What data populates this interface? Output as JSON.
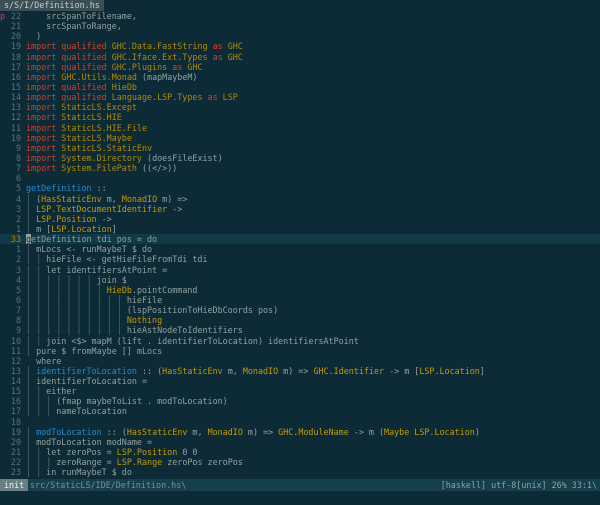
{
  "tab": {
    "title": "s/S/I/Definition.hs"
  },
  "sign_marker": "p",
  "lines": [
    {
      "n": "22",
      "sign": true,
      "segs": [
        [
          "i",
          "    "
        ],
        [
          "s",
          "srcSpanToFilename,"
        ]
      ]
    },
    {
      "n": "21",
      "segs": [
        [
          "i",
          "    "
        ],
        [
          "s",
          "srcSpanToRange,"
        ]
      ]
    },
    {
      "n": "20",
      "segs": [
        [
          "s",
          "  )"
        ]
      ]
    },
    {
      "n": "19",
      "segs": [
        [
          "k",
          "import qualified "
        ],
        [
          "m",
          "GHC.Data.FastString"
        ],
        [
          "k",
          " as "
        ],
        [
          "m",
          "GHC"
        ]
      ]
    },
    {
      "n": "18",
      "segs": [
        [
          "k",
          "import qualified "
        ],
        [
          "m",
          "GHC.Iface.Ext.Types"
        ],
        [
          "k",
          " as "
        ],
        [
          "m",
          "GHC"
        ]
      ]
    },
    {
      "n": "17",
      "segs": [
        [
          "k",
          "import qualified "
        ],
        [
          "m",
          "GHC.Plugins"
        ],
        [
          "k",
          " as "
        ],
        [
          "m",
          "GHC"
        ]
      ]
    },
    {
      "n": "16",
      "segs": [
        [
          "k",
          "import "
        ],
        [
          "m",
          "GHC.Utils.Monad"
        ],
        [
          "s",
          " (mapMaybeM)"
        ]
      ]
    },
    {
      "n": "15",
      "segs": [
        [
          "k",
          "import qualified "
        ],
        [
          "m",
          "HieDb"
        ]
      ]
    },
    {
      "n": "14",
      "segs": [
        [
          "k",
          "import qualified "
        ],
        [
          "m",
          "Language.LSP.Types"
        ],
        [
          "k",
          " as "
        ],
        [
          "m",
          "LSP"
        ]
      ]
    },
    {
      "n": "13",
      "segs": [
        [
          "k",
          "import "
        ],
        [
          "m",
          "StaticLS.Except"
        ]
      ]
    },
    {
      "n": "12",
      "segs": [
        [
          "k",
          "import "
        ],
        [
          "m",
          "StaticLS.HIE"
        ]
      ]
    },
    {
      "n": "11",
      "segs": [
        [
          "k",
          "import "
        ],
        [
          "m",
          "StaticLS.HIE.File"
        ]
      ]
    },
    {
      "n": "10",
      "segs": [
        [
          "k",
          "import "
        ],
        [
          "m",
          "StaticLS.Maybe"
        ]
      ]
    },
    {
      "n": "9",
      "segs": [
        [
          "k",
          "import "
        ],
        [
          "m",
          "StaticLS.StaticEnv"
        ]
      ]
    },
    {
      "n": "8",
      "segs": [
        [
          "k",
          "import "
        ],
        [
          "m",
          "System.Directory"
        ],
        [
          "s",
          " (doesFileExist)"
        ]
      ]
    },
    {
      "n": "7",
      "segs": [
        [
          "k",
          "import "
        ],
        [
          "m",
          "System.FilePath"
        ],
        [
          "s",
          " ((</>))"
        ]
      ]
    },
    {
      "n": "6",
      "segs": []
    },
    {
      "n": "5",
      "segs": [
        [
          "f",
          "getDefinition"
        ],
        [
          "s",
          " ::"
        ]
      ]
    },
    {
      "n": "4",
      "segs": [
        [
          "i",
          "│ "
        ],
        [
          "s",
          "("
        ],
        [
          "t",
          "HasStaticEnv"
        ],
        [
          "s",
          " m, "
        ],
        [
          "t",
          "MonadIO"
        ],
        [
          "s",
          " m) =>"
        ]
      ]
    },
    {
      "n": "3",
      "segs": [
        [
          "i",
          "│ "
        ],
        [
          "t",
          "LSP.TextDocumentIdentifier"
        ],
        [
          "s",
          " ->"
        ]
      ]
    },
    {
      "n": "2",
      "segs": [
        [
          "i",
          "│ "
        ],
        [
          "t",
          "LSP.Position"
        ],
        [
          "s",
          " ->"
        ]
      ]
    },
    {
      "n": "1",
      "segs": [
        [
          "i",
          "│ "
        ],
        [
          "s",
          "m ["
        ],
        [
          "t",
          "LSP.Location"
        ],
        [
          "s",
          "]"
        ]
      ]
    },
    {
      "n": "33",
      "cur": true,
      "segs": [
        [
          "cursor",
          "g"
        ],
        [
          "s",
          "etDefinition tdi pos = do"
        ]
      ]
    },
    {
      "n": "1",
      "segs": [
        [
          "i",
          "│ "
        ],
        [
          "s",
          "mLocs <- runMaybeT $ do"
        ]
      ]
    },
    {
      "n": "2",
      "segs": [
        [
          "i",
          "│ │ "
        ],
        [
          "s",
          "hieFile <- getHieFileFromTdi tdi"
        ]
      ]
    },
    {
      "n": "3",
      "segs": [
        [
          "i",
          "│ │ "
        ],
        [
          "s",
          "let identifiersAtPoint ="
        ]
      ]
    },
    {
      "n": "4",
      "segs": [
        [
          "i",
          "│ │ │ │ │ │ │ "
        ],
        [
          "s",
          "join $"
        ]
      ]
    },
    {
      "n": "5",
      "segs": [
        [
          "i",
          "│ │ │ │ │ │ │ │ "
        ],
        [
          "t",
          "HieDb"
        ],
        [
          "s",
          ".pointCommand"
        ]
      ]
    },
    {
      "n": "6",
      "segs": [
        [
          "i",
          "│ │ │ │ │ │ │ │ │ │ "
        ],
        [
          "s",
          "hieFile"
        ]
      ]
    },
    {
      "n": "7",
      "segs": [
        [
          "i",
          "│ │ │ │ │ │ │ │ │ │ "
        ],
        [
          "s",
          "(lspPositionToHieDbCoords pos)"
        ]
      ]
    },
    {
      "n": "8",
      "segs": [
        [
          "i",
          "│ │ │ │ │ │ │ │ │ │ "
        ],
        [
          "t",
          "Nothing"
        ]
      ]
    },
    {
      "n": "9",
      "segs": [
        [
          "i",
          "│ │ │ │ │ │ │ │ │ │ "
        ],
        [
          "s",
          "hieAstNodeToIdentifiers"
        ]
      ]
    },
    {
      "n": "10",
      "segs": [
        [
          "i",
          "│ │ "
        ],
        [
          "s",
          "join <$> mapM (lift . identifierToLocation) identifiersAtPoint"
        ]
      ]
    },
    {
      "n": "11",
      "segs": [
        [
          "i",
          "│ "
        ],
        [
          "s",
          "pure $ fromMaybe [] mLocs"
        ]
      ]
    },
    {
      "n": "12",
      "segs": [
        [
          "s",
          "  where"
        ]
      ]
    },
    {
      "n": "13",
      "segs": [
        [
          "i",
          "│ "
        ],
        [
          "f",
          "identifierToLocation"
        ],
        [
          "s",
          " :: ("
        ],
        [
          "t",
          "HasStaticEnv"
        ],
        [
          "s",
          " m, "
        ],
        [
          "t",
          "MonadIO"
        ],
        [
          "s",
          " m) => "
        ],
        [
          "t",
          "GHC.Identifier"
        ],
        [
          "s",
          " -> m ["
        ],
        [
          "t",
          "LSP.Location"
        ],
        [
          "s",
          "]"
        ]
      ]
    },
    {
      "n": "14",
      "segs": [
        [
          "i",
          "│ "
        ],
        [
          "s",
          "identifierToLocation ="
        ]
      ]
    },
    {
      "n": "15",
      "segs": [
        [
          "i",
          "│ │ "
        ],
        [
          "s",
          "either"
        ]
      ]
    },
    {
      "n": "16",
      "segs": [
        [
          "i",
          "│ │ │ "
        ],
        [
          "s",
          "(fmap maybeToList . modToLocation)"
        ]
      ]
    },
    {
      "n": "17",
      "segs": [
        [
          "i",
          "│ │ │ "
        ],
        [
          "s",
          "nameToLocation"
        ]
      ]
    },
    {
      "n": "18",
      "segs": []
    },
    {
      "n": "19",
      "segs": [
        [
          "i",
          "│ "
        ],
        [
          "f",
          "modToLocation"
        ],
        [
          "s",
          " :: ("
        ],
        [
          "t",
          "HasStaticEnv"
        ],
        [
          "s",
          " m, "
        ],
        [
          "t",
          "MonadIO"
        ],
        [
          "s",
          " m) => "
        ],
        [
          "t",
          "GHC.ModuleName"
        ],
        [
          "s",
          " -> m ("
        ],
        [
          "t",
          "Maybe LSP.Location"
        ],
        [
          "s",
          ")"
        ]
      ]
    },
    {
      "n": "20",
      "segs": [
        [
          "i",
          "│ "
        ],
        [
          "s",
          "modToLocation modName ="
        ]
      ]
    },
    {
      "n": "21",
      "segs": [
        [
          "i",
          "│ │ "
        ],
        [
          "s",
          "let zeroPos = "
        ],
        [
          "t",
          "LSP.Position"
        ],
        [
          "s",
          " 0 0"
        ]
      ]
    },
    {
      "n": "22",
      "segs": [
        [
          "i",
          "│ │ │ "
        ],
        [
          "s",
          "zeroRange = "
        ],
        [
          "t",
          "LSP.Range"
        ],
        [
          "s",
          " zeroPos zeroPos"
        ]
      ]
    },
    {
      "n": "23",
      "segs": [
        [
          "i",
          "│ │ "
        ],
        [
          "s",
          "in runMaybeT $ do"
        ]
      ]
    }
  ],
  "status": {
    "mode": "init",
    "filename": "src/StaticLS/IDE/Definition.hs\\",
    "right": "[haskell] utf-8[unix] 26% 33:1\\"
  }
}
